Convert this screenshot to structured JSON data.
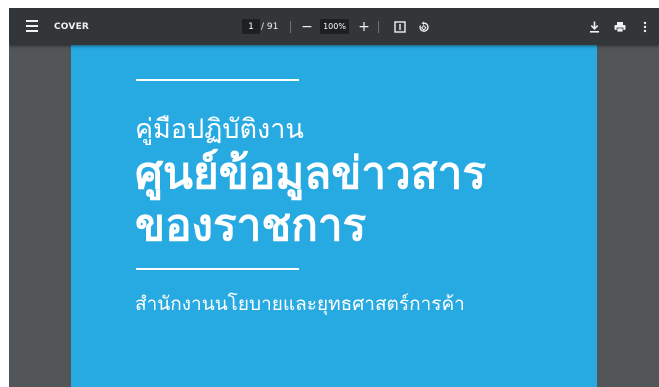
{
  "toolbar": {
    "title": "COVER",
    "current_page": "1",
    "page_total": "/ 91",
    "zoom_out_label": "−",
    "zoom_value": "100%",
    "zoom_in_label": "+",
    "icons": [
      "menu-icon",
      "fit-page-icon",
      "rotate-icon",
      "download-icon",
      "print-icon",
      "more-options-icon"
    ]
  },
  "document": {
    "background_color": "#27aae1",
    "subtitle": "คู่มือปฏิบัติงาน",
    "title_line1": "ศูนย์ข้อมูลข่าวสาร",
    "title_line2": "ของราชการ",
    "agency": "สำนักงานนโยบายและยุทธศาสตร์การค้า"
  }
}
